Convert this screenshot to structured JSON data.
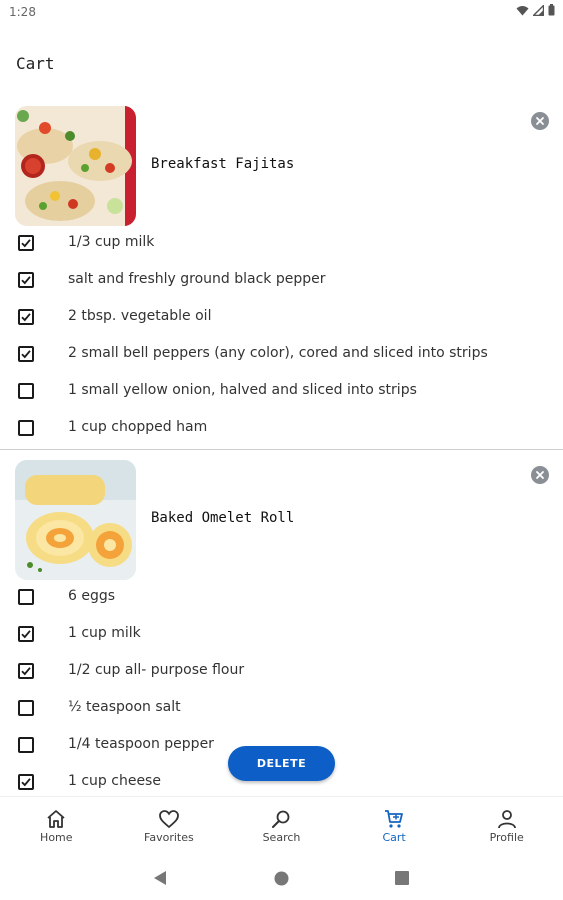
{
  "status": {
    "time": "1:28"
  },
  "header": {
    "title": "Cart"
  },
  "recipes": [
    {
      "name": "Breakfast Fajitas",
      "image_icon": "fajitas-photo",
      "ingredients": [
        {
          "text": "1/3 cup milk",
          "checked": true
        },
        {
          "text": "salt and freshly ground black pepper",
          "checked": true
        },
        {
          "text": "2 tbsp. vegetable oil",
          "checked": true
        },
        {
          "text": "2 small bell peppers (any color), cored and sliced into strips",
          "checked": true
        },
        {
          "text": "1 small yellow onion, halved and sliced into strips",
          "checked": false
        },
        {
          "text": "1 cup chopped ham",
          "checked": false
        }
      ]
    },
    {
      "name": "Baked Omelet Roll",
      "image_icon": "omelet-roll-photo",
      "ingredients": [
        {
          "text": "6 eggs",
          "checked": false
        },
        {
          "text": "1 cup milk",
          "checked": true
        },
        {
          "text": "1/2 cup all- purpose flour",
          "checked": true
        },
        {
          "text": "½ teaspoon salt",
          "checked": false
        },
        {
          "text": "1/4 teaspoon pepper",
          "checked": false
        },
        {
          "text": "1 cup cheese",
          "checked": true
        }
      ]
    }
  ],
  "delete_button": {
    "label": "DELETE"
  },
  "bottom_nav": [
    {
      "label": "Home",
      "icon": "home-icon",
      "active": false
    },
    {
      "label": "Favorites",
      "icon": "heart-icon",
      "active": false
    },
    {
      "label": "Search",
      "icon": "search-icon",
      "active": false
    },
    {
      "label": "Cart",
      "icon": "cart-icon",
      "active": true
    },
    {
      "label": "Profile",
      "icon": "person-icon",
      "active": false
    }
  ],
  "colors": {
    "accent": "#1565c0",
    "delete": "#0d5ec7"
  }
}
